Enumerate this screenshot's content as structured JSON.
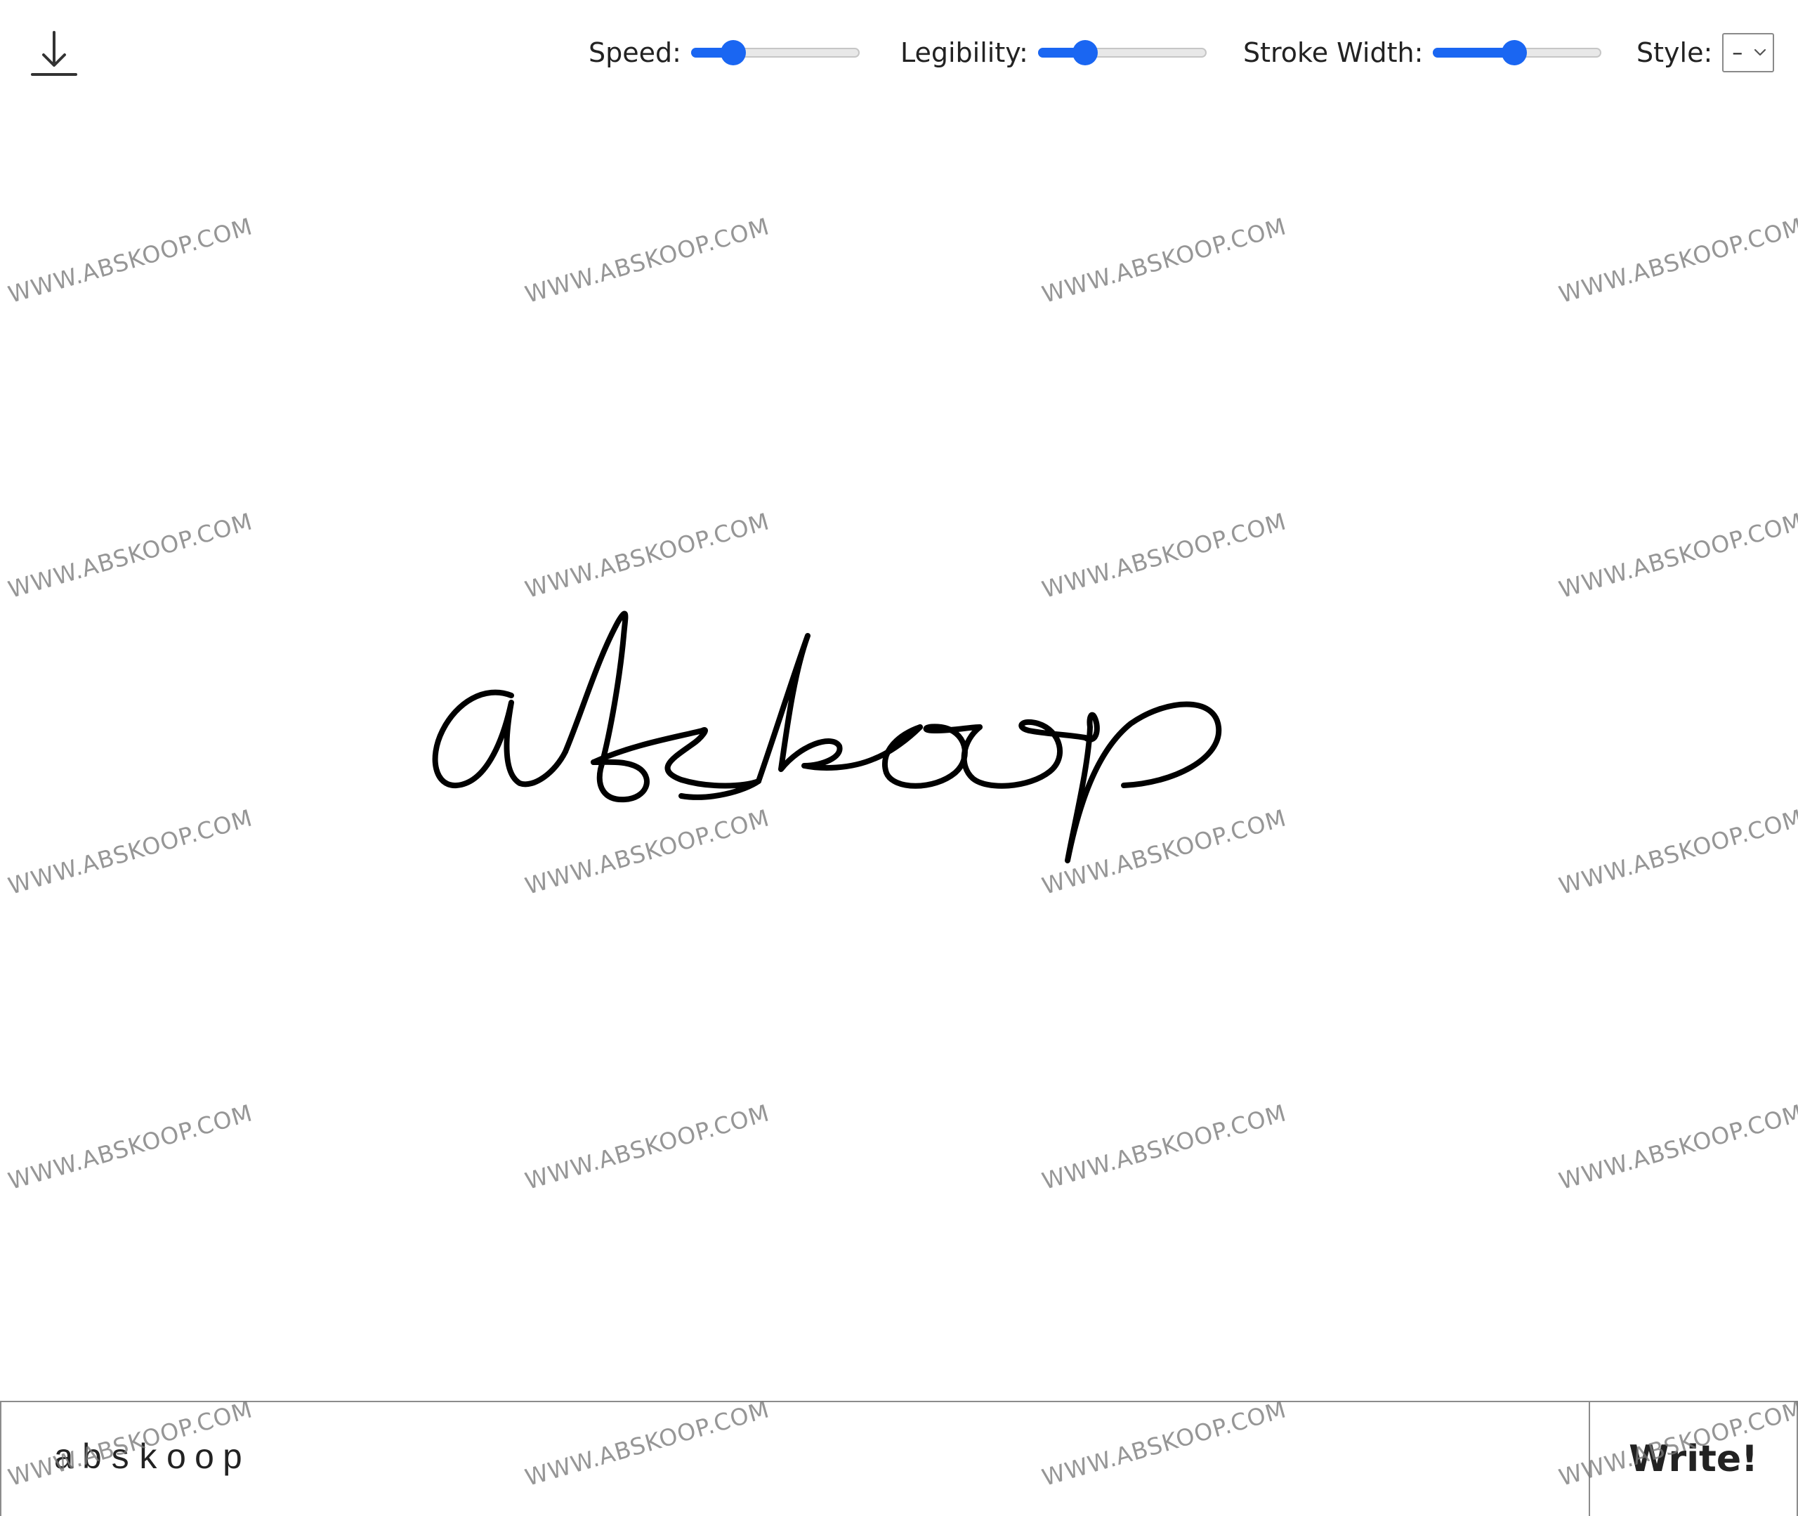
{
  "toolbar": {
    "download_icon": "download-icon",
    "speed": {
      "label": "Speed:",
      "value": 0.25
    },
    "legibility": {
      "label": "Legibility:",
      "value": 0.28
    },
    "stroke_width": {
      "label": "Stroke Width:",
      "value": 0.48
    },
    "style": {
      "label": "Style:",
      "selected": "–",
      "icon": "chevron-down-icon"
    }
  },
  "canvas": {
    "handwritten_text": "abskoop",
    "stroke_color": "#000000"
  },
  "input": {
    "value": "abskoop"
  },
  "write_button": {
    "label": "Write!"
  },
  "watermark": {
    "text": "WWW.ABSKOOP.COM"
  },
  "colors": {
    "slider_accent": "#1a66f2",
    "slider_track": "#e8e8e8"
  }
}
